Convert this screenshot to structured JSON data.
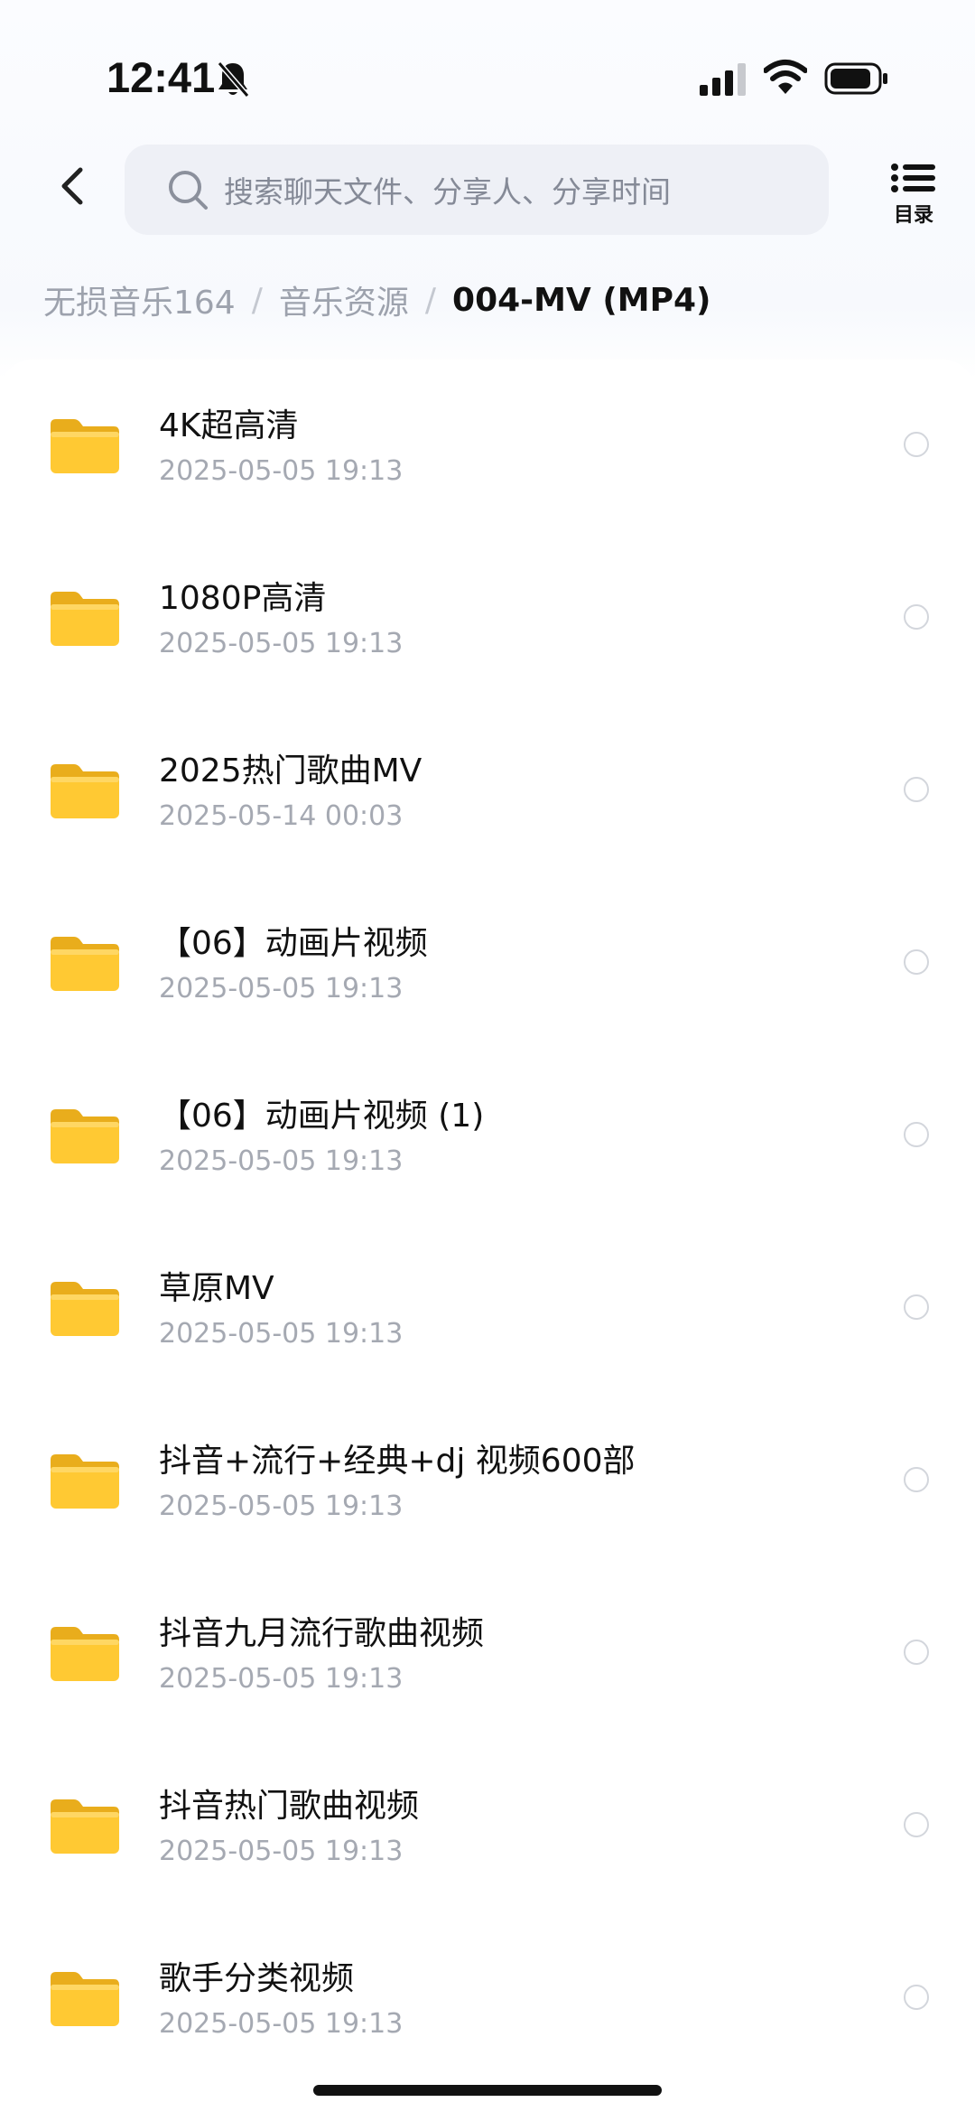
{
  "status_bar": {
    "time": "12:41",
    "icons": [
      "bell-slash-icon",
      "signal-icon",
      "wifi-icon",
      "battery-icon"
    ]
  },
  "header": {
    "back_icon": "chevron-left-icon",
    "search_placeholder": "搜索聊天文件、分享人、分享时间",
    "toc_label": "目录",
    "toc_icon": "list-icon"
  },
  "breadcrumb": {
    "items": [
      "无损音乐164",
      "音乐资源"
    ],
    "separator": "/",
    "current": "004-MV (MP4)"
  },
  "files": [
    {
      "name": "4K超高清",
      "date": "2025-05-05 19:13",
      "icon": "folder-icon"
    },
    {
      "name": "1080P高清",
      "date": "2025-05-05 19:13",
      "icon": "folder-icon"
    },
    {
      "name": "2025热门歌曲MV",
      "date": "2025-05-14 00:03",
      "icon": "folder-icon"
    },
    {
      "name": "【06】动画片视频",
      "date": "2025-05-05 19:13",
      "icon": "folder-icon"
    },
    {
      "name": "【06】动画片视频 (1)",
      "date": "2025-05-05 19:13",
      "icon": "folder-icon"
    },
    {
      "name": "草原MV",
      "date": "2025-05-05 19:13",
      "icon": "folder-icon"
    },
    {
      "name": "抖音+流行+经典+dj 视频600部",
      "date": "2025-05-05 19:13",
      "icon": "folder-icon"
    },
    {
      "name": "抖音九月流行歌曲视频",
      "date": "2025-05-05 19:13",
      "icon": "folder-icon"
    },
    {
      "name": "抖音热门歌曲视频",
      "date": "2025-05-05 19:13",
      "icon": "folder-icon"
    },
    {
      "name": "歌手分类视频",
      "date": "2025-05-05 19:13",
      "icon": "folder-icon"
    }
  ],
  "colors": {
    "folder": "#ffc933",
    "search_bg": "#eef0f6",
    "secondary_text": "#a5a9b2"
  }
}
